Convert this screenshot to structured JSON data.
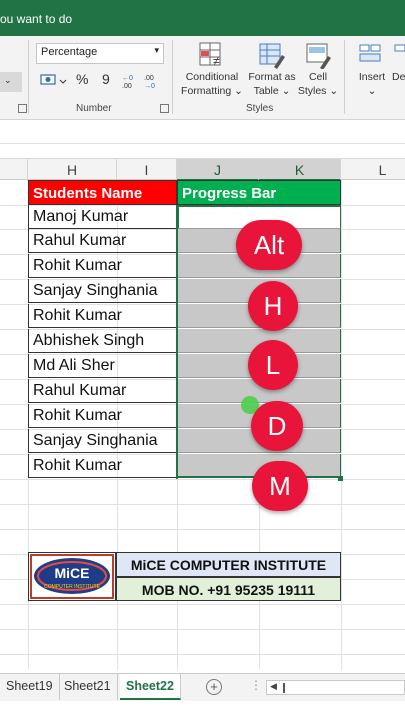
{
  "titlebar": {
    "tell_me": "ou want to do"
  },
  "ribbon": {
    "number_format": "Percentage",
    "number_group_label": "Number",
    "styles_group_label": "Styles",
    "percent_symbol": "%",
    "comma_symbol": "9",
    "conditional_formatting": "Conditional",
    "conditional_formatting_2": "Formatting",
    "format_as_table": "Format as",
    "format_as_table_2": "Table",
    "cell_styles": "Cell",
    "cell_styles_2": "Styles",
    "insert": "Insert",
    "delete": "De"
  },
  "columns": [
    "H",
    "I",
    "J",
    "K",
    "L"
  ],
  "table": {
    "header_name": "Students Name",
    "header_progress": "Progress Bar",
    "students": [
      "Manoj Kumar",
      "Rahul Kumar",
      "Rohit Kumar",
      "Sanjay Singhania",
      "Rohit Kumar",
      "Abhishek Singh",
      "Md Ali Sher",
      "Rahul Kumar",
      "Rohit Kumar",
      "Sanjay Singhania",
      "Rohit Kumar"
    ]
  },
  "keys": [
    "Alt",
    "H",
    "L",
    "D",
    "M"
  ],
  "institute": {
    "logo_text": "MiCE",
    "logo_sub": "COMPUTER INSTITUTE",
    "name": "MiCE COMPUTER INSTITUTE",
    "mobile": "MOB NO. +91 95235 19111"
  },
  "sheets": [
    "Sheet19",
    "Sheet21",
    "Sheet22"
  ],
  "active_sheet": "Sheet22",
  "colors": {
    "excel_green": "#217346",
    "header_red": "#ff0000",
    "header_green": "#00b050",
    "key_red": "#e8143a"
  }
}
